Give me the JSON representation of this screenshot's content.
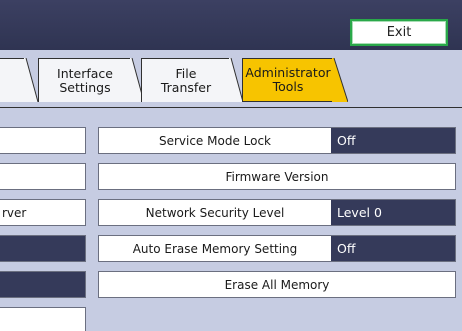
{
  "header": {
    "exit_label": "Exit"
  },
  "tabs": [
    {
      "line1": "Interface",
      "line2": "Settings",
      "active": false
    },
    {
      "line1": "File",
      "line2": "Transfer",
      "active": false
    },
    {
      "line1": "Administrator",
      "line2": "Tools",
      "active": true
    }
  ],
  "left_column": {
    "row3_text": "rver"
  },
  "settings": [
    {
      "label": "Service Mode Lock",
      "value": "Off"
    },
    {
      "label": "Firmware Version"
    },
    {
      "label": "Network Security Level",
      "value": "Level 0"
    },
    {
      "label": "Auto Erase Memory Setting",
      "value": "Off"
    },
    {
      "label": "Erase All Memory"
    }
  ],
  "colors": {
    "panel_bg": "#c6cce2",
    "header_bg": "#2f3452",
    "active_tab": "#f7c400",
    "value_bg": "#353a5a",
    "exit_border": "#2aa84a"
  }
}
